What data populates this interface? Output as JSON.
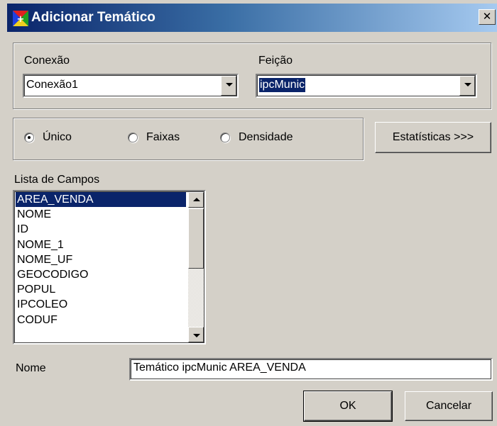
{
  "window": {
    "title": "Adicionar Temático",
    "close_glyph": "✕"
  },
  "conexao": {
    "label": "Conexão",
    "value": "Conexão1"
  },
  "feicao": {
    "label": "Feição",
    "value": "ipcMunic"
  },
  "mode": {
    "options": [
      "Único",
      "Faixas",
      "Densidade"
    ],
    "selected": "Único"
  },
  "buttons": {
    "statistics": "Estatísticas >>>",
    "ok": "OK",
    "cancel": "Cancelar"
  },
  "field_list": {
    "label": "Lista de Campos",
    "items": [
      "AREA_VENDA",
      "NOME",
      "ID",
      "NOME_1",
      "NOME_UF",
      "GEOCODIGO",
      "POPUL",
      "IPCOLEO",
      "CODUF"
    ],
    "selected": "AREA_VENDA"
  },
  "nome": {
    "label": "Nome",
    "value": "Temático ipcMunic AREA_VENDA"
  },
  "icons": {
    "app": "tematico-app-icon",
    "close": "close-icon",
    "dropdown": "chevron-down-icon",
    "scroll_up": "scroll-up-icon",
    "scroll_down": "scroll-down-icon"
  },
  "colors": {
    "title_gradient_start": "#0a246a",
    "title_gradient_end": "#a6caf0",
    "window_face": "#d4d0c8",
    "selection": "#0a246a"
  }
}
